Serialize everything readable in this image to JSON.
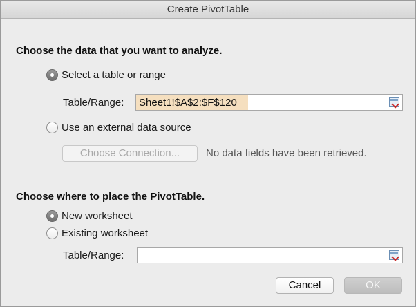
{
  "window": {
    "title": "Create PivotTable"
  },
  "source": {
    "heading": "Choose the data that you want to analyze.",
    "option_range": {
      "label": "Select a table or range",
      "selected": true
    },
    "range_label": "Table/Range:",
    "range_value": "Sheet1!$A$2:$F$120",
    "option_external": {
      "label": "Use an external data source",
      "selected": false
    },
    "choose_connection_label": "Choose Connection...",
    "connection_status": "No data fields have been retrieved."
  },
  "destination": {
    "heading": "Choose where to place the PivotTable.",
    "option_new": {
      "label": "New worksheet",
      "selected": true
    },
    "option_existing": {
      "label": "Existing worksheet",
      "selected": false
    },
    "range_label": "Table/Range:",
    "range_value": ""
  },
  "buttons": {
    "cancel": "Cancel",
    "ok": "OK"
  },
  "icons": {
    "range_picker": "range-select-icon"
  }
}
